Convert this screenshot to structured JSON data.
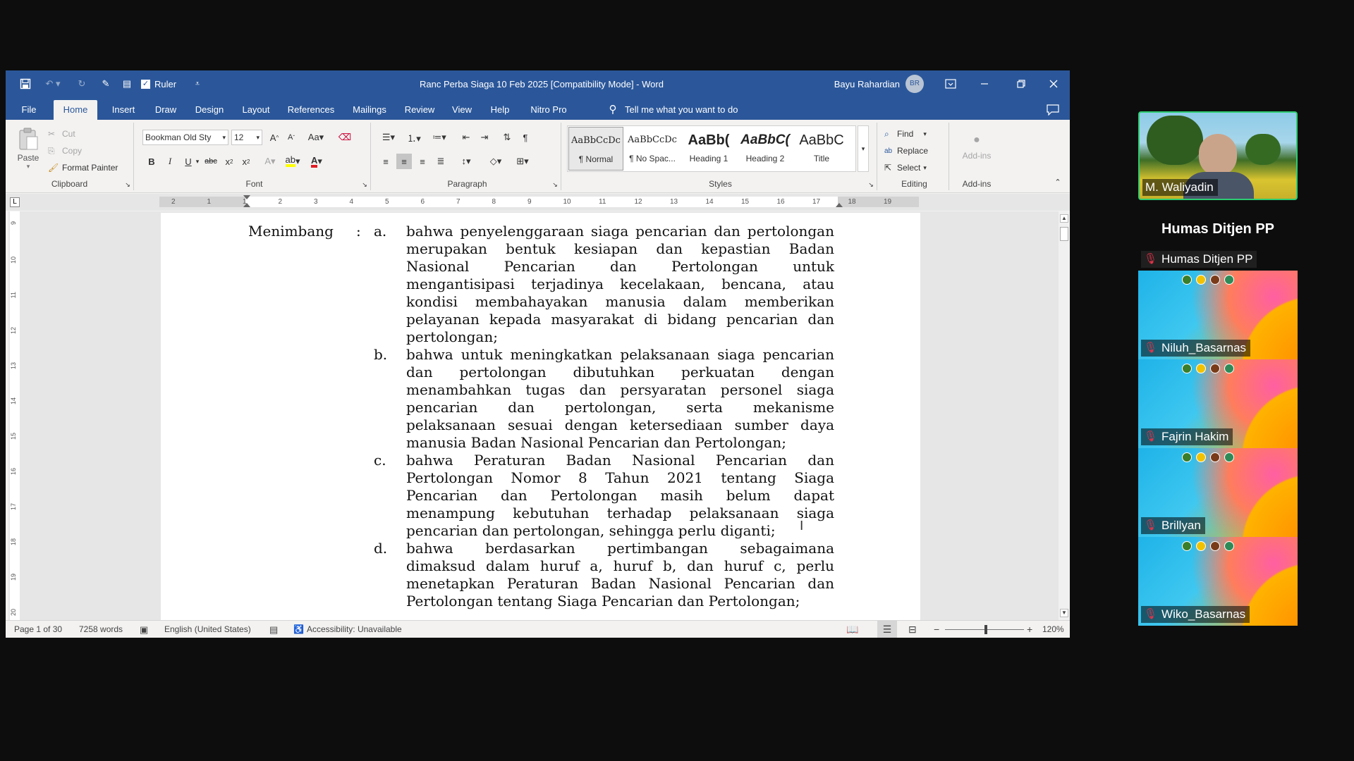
{
  "window": {
    "title": "Ranc Perba Siaga 10 Feb 2025 [Compatibility Mode]  -  Word",
    "user": "Bayu Rahardian",
    "user_initials": "BR",
    "qat_ruler_label": "Ruler"
  },
  "tabs": [
    "File",
    "Home",
    "Insert",
    "Draw",
    "Design",
    "Layout",
    "References",
    "Mailings",
    "Review",
    "View",
    "Help",
    "Nitro Pro"
  ],
  "active_tab": "Home",
  "tell_me": "Tell me what you want to do",
  "ribbon": {
    "clipboard": {
      "paste": "Paste",
      "cut": "Cut",
      "copy": "Copy",
      "format_painter": "Format Painter",
      "label": "Clipboard"
    },
    "font": {
      "name": "Bookman Old Sty",
      "size": "12",
      "label": "Font"
    },
    "paragraph": {
      "label": "Paragraph"
    },
    "styles": {
      "label": "Styles",
      "items": [
        {
          "preview": "AaBbCcDc",
          "name": "¶ Normal"
        },
        {
          "preview": "AaBbCcDc",
          "name": "¶ No Spac..."
        },
        {
          "preview": "AaBb(",
          "name": "Heading 1"
        },
        {
          "preview": "AaBbC(",
          "name": "Heading 2"
        },
        {
          "preview": "AaBbC",
          "name": "Title"
        }
      ]
    },
    "editing": {
      "find": "Find",
      "replace": "Replace",
      "select": "Select",
      "label": "Editing"
    },
    "addins": {
      "button": "Add-ins",
      "label": "Add-ins"
    }
  },
  "ruler_numbers": [
    "2",
    "1",
    "1",
    "2",
    "3",
    "4",
    "5",
    "6",
    "7",
    "8",
    "9",
    "10",
    "11",
    "12",
    "13",
    "14",
    "15",
    "16",
    "17",
    "18",
    "19"
  ],
  "vruler_numbers": [
    "9",
    "10",
    "11",
    "12",
    "13",
    "14",
    "15",
    "16",
    "17",
    "18",
    "19",
    "20"
  ],
  "document": {
    "heading": "Menimbang",
    "colon": ":",
    "items": [
      {
        "letter": "a.",
        "lines": [
          "bahwa penyelenggaraan siaga pencarian dan pertolongan",
          "merupakan bentuk kesiapan dan kepastian Badan",
          "Nasional Pencarian dan Pertolongan untuk",
          "mengantisipasi terjadinya kecelakaan, bencana, atau",
          "kondisi membahayakan manusia dalam memberikan",
          "pelayanan kepada masyarakat di bidang pencarian dan",
          "pertolongan;"
        ]
      },
      {
        "letter": "b.",
        "lines": [
          "bahwa untuk meningkatkan pelaksanaan siaga pencarian",
          "dan pertolongan dibutuhkan perkuatan dengan",
          "menambahkan tugas dan persyaratan personel siaga",
          "pencarian dan pertolongan, serta mekanisme",
          "pelaksanaan sesuai dengan ketersediaan sumber daya",
          "manusia Badan Nasional Pencarian dan Pertolongan;"
        ]
      },
      {
        "letter": "c.",
        "lines": [
          "bahwa Peraturan Badan Nasional Pencarian dan",
          "Pertolongan Nomor 8 Tahun 2021 tentang Siaga",
          "Pencarian dan Pertolongan masih belum dapat",
          "menampung kebutuhan terhadap pelaksanaan siaga",
          "pencarian dan pertolongan, sehingga perlu diganti;"
        ]
      },
      {
        "letter": "d.",
        "lines": [
          "bahwa berdasarkan pertimbangan sebagaimana",
          "dimaksud dalam huruf a, huruf b, dan huruf c, perlu",
          "menetapkan Peraturan Badan Nasional Pencarian dan",
          "Pertolongan tentang Siaga Pencarian dan Pertolongan;"
        ]
      }
    ]
  },
  "status": {
    "page": "Page 1 of 30",
    "words": "7258 words",
    "language": "English (United States)",
    "accessibility": "Accessibility: Unavailable",
    "zoom": "120%",
    "zoom_minus": "−",
    "zoom_plus": "+"
  },
  "meeting": {
    "main_participant": "M. Waliyadin",
    "section_title": "Humas Ditjen PP",
    "participants": [
      "Humas Ditjen PP",
      "Niluh_Basarnas",
      "Fajrin Hakim",
      "Brillyan",
      "Wiko_Basarnas"
    ]
  },
  "colors": {
    "word_blue": "#2b579a",
    "accent_green": "#2ecc71",
    "spelling_red": "#e01b24",
    "mic_red": "#e0334a"
  }
}
